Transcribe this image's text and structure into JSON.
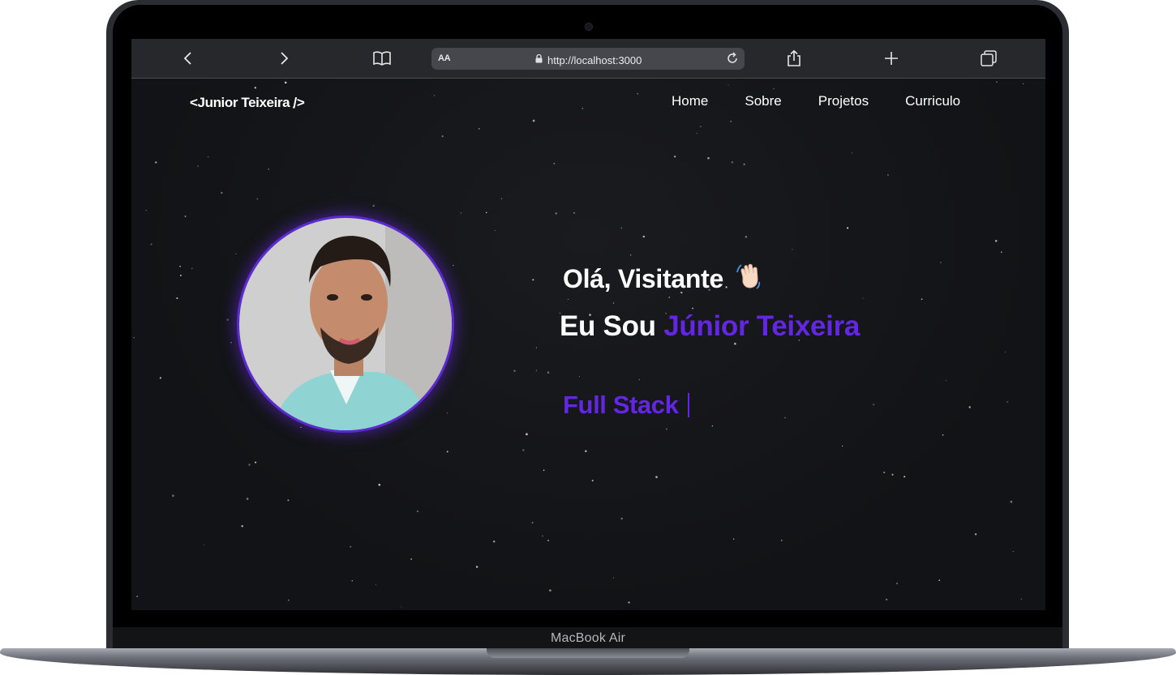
{
  "device": {
    "label": "MacBook Air"
  },
  "browser": {
    "text_size_label": "AA",
    "url": "http://localhost:3000",
    "icons": {
      "back": "chevron-left-icon",
      "forward": "chevron-right-icon",
      "reader": "book-icon",
      "lock": "lock-icon",
      "reload": "reload-icon",
      "share": "share-icon",
      "new_tab": "plus-icon",
      "tabs": "tabs-icon"
    }
  },
  "site": {
    "logo": "<Junior Teixeira />",
    "nav": [
      "Home",
      "Sobre",
      "Projetos",
      "Curriculo"
    ]
  },
  "hero": {
    "greeting": "Olá, Visitante",
    "greeting_icon": "waving-hand-icon",
    "intro_prefix": "Eu Sou",
    "name": "Júnior Teixeira",
    "role": "Full Stack"
  },
  "colors": {
    "accent": "#6326e2",
    "page_background": "#16171a",
    "text": "#ffffff"
  }
}
